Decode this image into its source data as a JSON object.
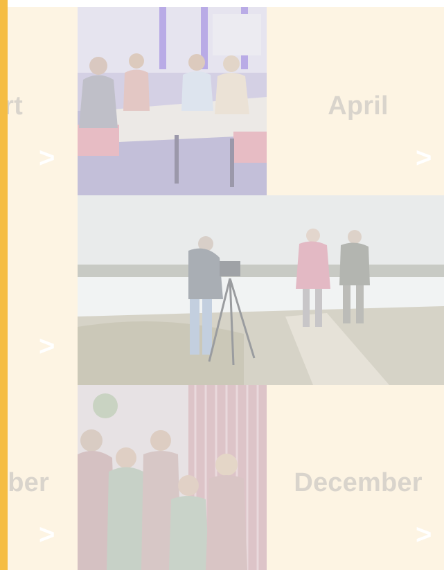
{
  "tiles": {
    "left_top": {
      "label": "rt",
      "arrow": ">"
    },
    "april": {
      "label": "April",
      "arrow": ">"
    },
    "left_middle": {
      "label": "",
      "arrow": ">"
    },
    "left_bottom": {
      "label": "ber",
      "arrow": ">"
    },
    "december": {
      "label": "December",
      "arrow": ">"
    }
  },
  "colors": {
    "accent_bar": "#f5bd43",
    "tile_background": "#fdf4e3",
    "label_text": "#d9d4cc",
    "arrow": "#ffffff"
  },
  "photos": {
    "studio": {
      "icon": "studio-talkshow-photo"
    },
    "outdoor": {
      "icon": "outdoor-filming-photo"
    },
    "xmas": {
      "icon": "christmas-group-photo"
    }
  }
}
